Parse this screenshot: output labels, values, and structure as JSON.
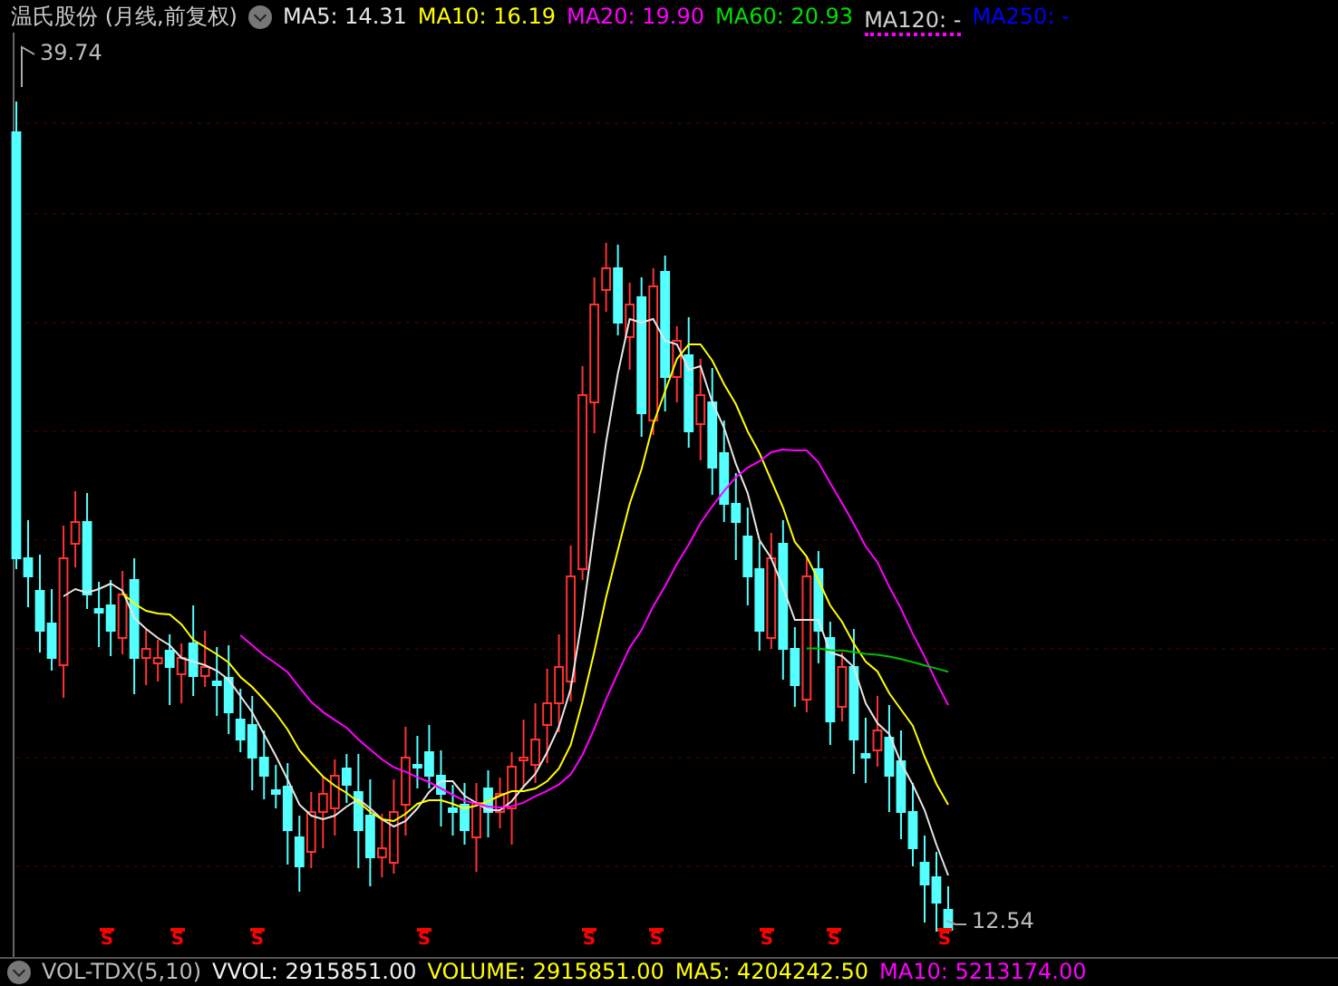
{
  "header": {
    "title": "温氏股份 (月线,前复权)",
    "indicators": [
      {
        "label": "MA5: 14.31",
        "color": "#e6e6e6",
        "dotted_underline": false
      },
      {
        "label": "MA10: 16.19",
        "color": "#ffff00",
        "dotted_underline": false
      },
      {
        "label": "MA20: 19.90",
        "color": "#ff00ff",
        "dotted_underline": false
      },
      {
        "label": "MA60: 20.93",
        "color": "#00e000",
        "dotted_underline": false
      },
      {
        "label": "MA120: -",
        "color": "#d0d0d0",
        "dotted_underline": true
      },
      {
        "label": "MA250: -",
        "color": "#0000ff",
        "dotted_underline": false
      }
    ]
  },
  "chart": {
    "high_label": "39.74",
    "low_label": "12.54",
    "signal_markers": [
      "S",
      "S",
      "S",
      "S",
      "S",
      "S",
      "S",
      "S",
      "S"
    ]
  },
  "footer": {
    "indicator_name": "VOL-TDX(5,10)",
    "readings": [
      {
        "label": "VVOL: 2915851.00",
        "color": "#f0f0f0"
      },
      {
        "label": "VOLUME: 2915851.00",
        "color": "#ffff00"
      },
      {
        "label": "MA5: 4204242.50",
        "color": "#ffff00"
      },
      {
        "label": "MA10: 5213174.00",
        "color": "#ff00ff"
      }
    ]
  }
}
